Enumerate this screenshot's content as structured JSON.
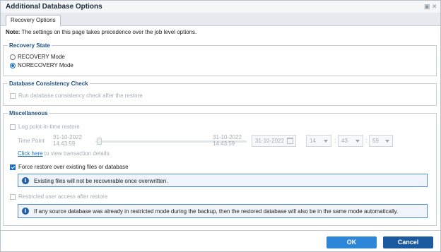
{
  "window": {
    "title": "Additional Database Options"
  },
  "tabs": [
    {
      "label": "Recovery Options"
    }
  ],
  "note": {
    "prefix": "Note:",
    "text": "The settings on this page takes precedence over the job level options."
  },
  "recovery_state": {
    "title": "Recovery State",
    "options": [
      {
        "label": "RECOVERY Mode",
        "selected": false
      },
      {
        "label": "NORECOVERY Mode",
        "selected": true
      }
    ]
  },
  "consistency": {
    "title": "Database Consistency Check",
    "checkbox_label": "Run database consistency check after the restore",
    "checked": false,
    "enabled": false
  },
  "misc": {
    "title": "Miscellaneous",
    "pit_label": "Log point-in-time restore",
    "pit_checked": false,
    "time_point_label": "Time Point",
    "range_start": {
      "date": "31-10-2022",
      "time": "14:43:59"
    },
    "range_end": {
      "date": "31-10-2022",
      "time": "14:43:59"
    },
    "slider_position": 0.0,
    "date_value": "31-10-2022",
    "hour": "14",
    "minute": "43",
    "second": "59",
    "time_separator": ":",
    "link_text": "Click here",
    "link_suffix": " to view transaction details.",
    "force_label": "Force restore over existing files or database",
    "force_checked": true,
    "force_info": "Existing files will not be recoverable once overwritten.",
    "restricted_label": "Restricted user access after restore",
    "restricted_checked": false,
    "restricted_info": "If any source database was already in restricted mode during the backup, then the restored database will also be in the same mode automatically."
  },
  "buttons": {
    "ok": "OK",
    "cancel": "Cancel"
  },
  "colors": {
    "accent": "#1b6fc9",
    "section_title": "#1f4f82",
    "ok_button": "#2e86d8",
    "cancel_button": "#1c5aa0",
    "info_border": "#4f8fd0"
  },
  "icons": {
    "maximize": "maximize-icon",
    "close": "close-icon",
    "info": "info-icon",
    "calendar": "calendar-icon"
  }
}
